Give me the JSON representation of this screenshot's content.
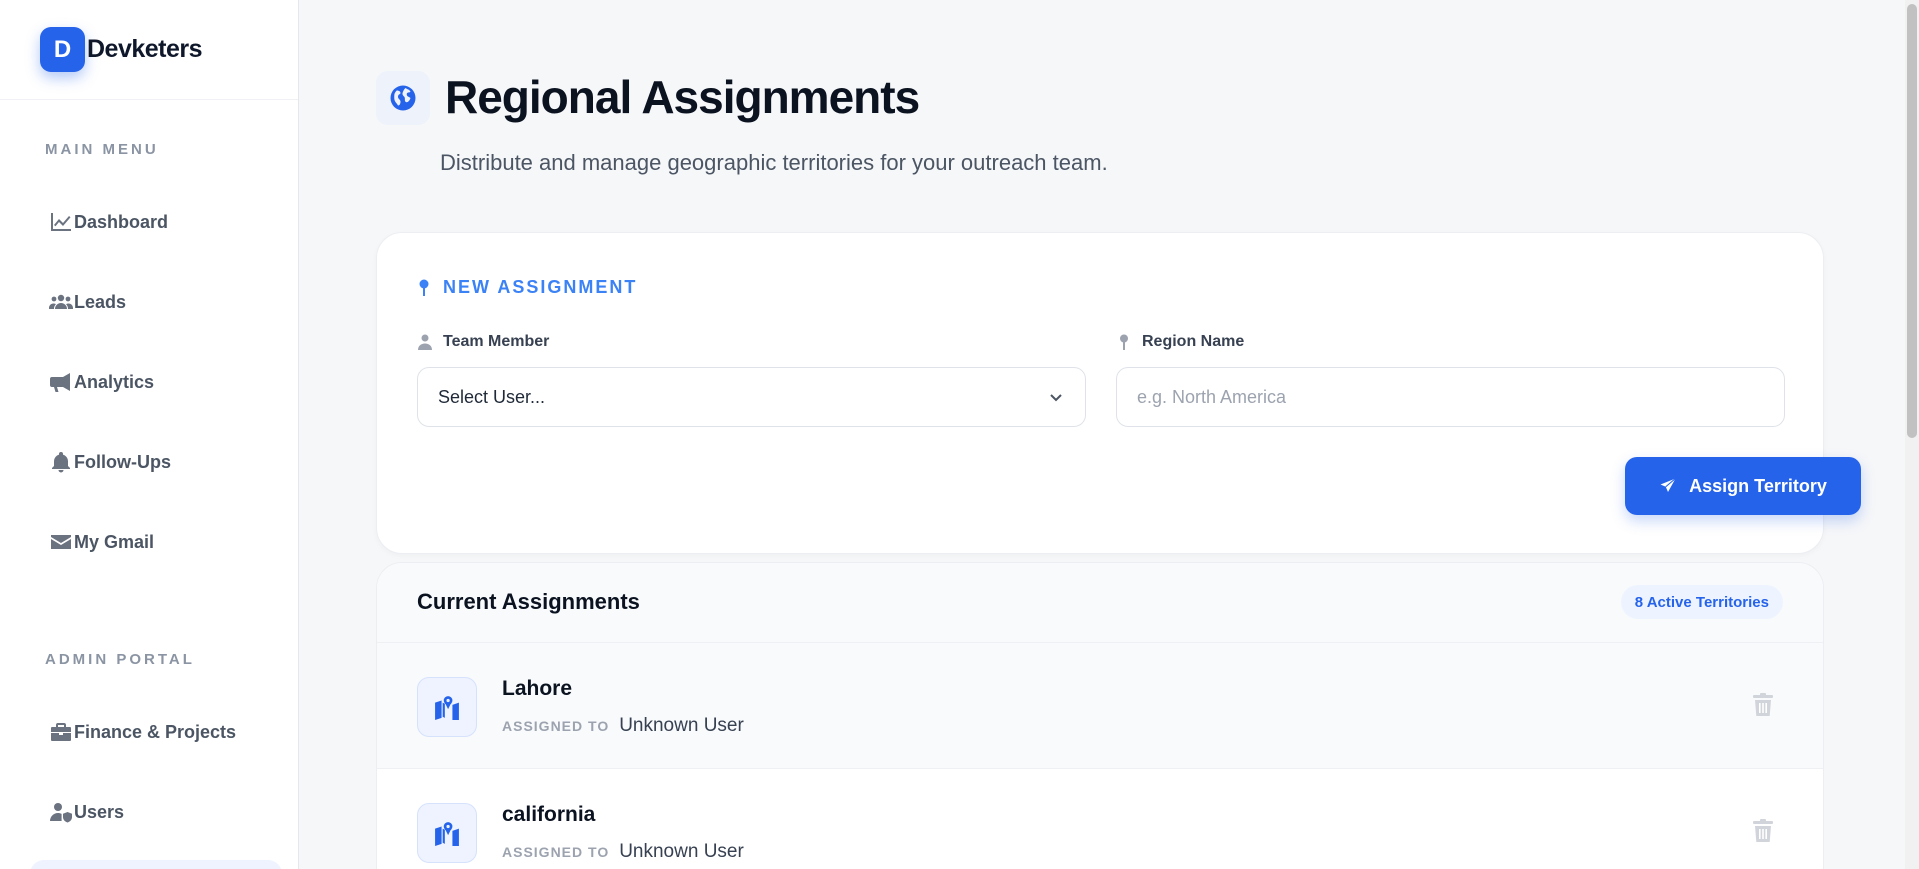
{
  "brand": {
    "logo_letter": "D",
    "name": "Devketers",
    "accent": "#2563eb"
  },
  "sidebar": {
    "main_menu_label": "MAIN MENU",
    "main_items": [
      {
        "label": "Dashboard",
        "icon": "chart-line-icon"
      },
      {
        "label": "Leads",
        "icon": "users-icon"
      },
      {
        "label": "Analytics",
        "icon": "megaphone-icon"
      },
      {
        "label": "Follow-Ups",
        "icon": "bell-icon"
      },
      {
        "label": "My Gmail",
        "icon": "envelope-icon"
      }
    ],
    "admin_label": "ADMIN PORTAL",
    "admin_items": [
      {
        "label": "Finance & Projects",
        "icon": "briefcase-icon"
      },
      {
        "label": "Users",
        "icon": "user-shield-icon"
      }
    ]
  },
  "page": {
    "title": "Regional Assignments",
    "subtitle": "Distribute and manage geographic territories for your outreach team.",
    "icon": "globe-icon"
  },
  "form": {
    "section_title": "NEW ASSIGNMENT",
    "team_member_label": "Team Member",
    "team_member_value": "Select User...",
    "region_label": "Region Name",
    "region_placeholder": "e.g. North America",
    "region_value": "",
    "submit_label": "Assign Territory"
  },
  "assignments": {
    "title": "Current Assignments",
    "count_badge": "8 Active Territories",
    "assigned_to_label": "ASSIGNED TO",
    "rows": [
      {
        "region": "Lahore",
        "user": "Unknown User"
      },
      {
        "region": "california",
        "user": "Unknown User"
      }
    ]
  }
}
